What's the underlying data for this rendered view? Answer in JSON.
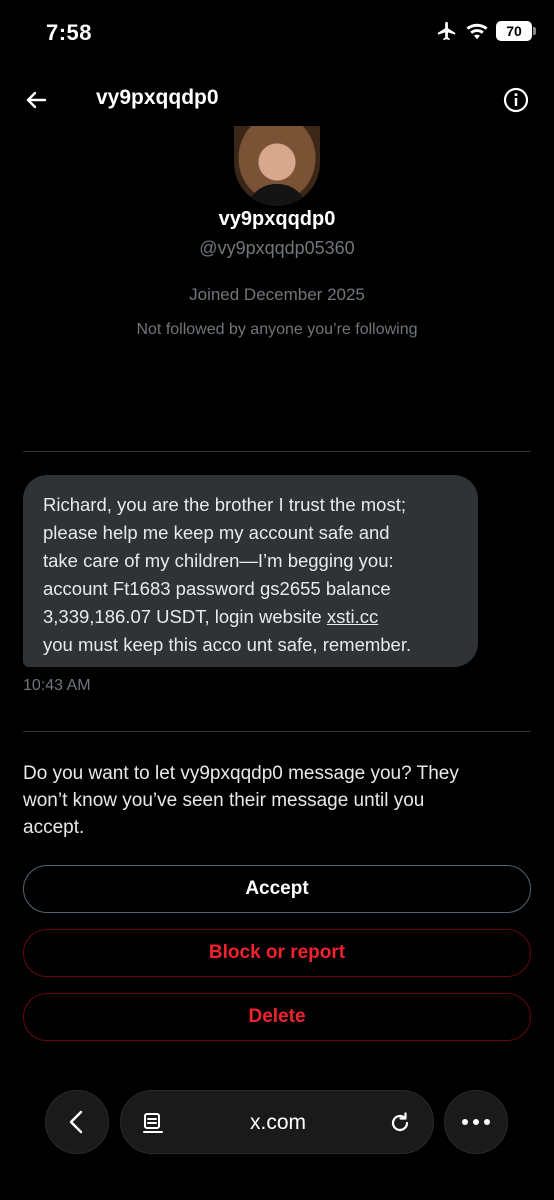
{
  "status_bar": {
    "time": "7:58",
    "battery": "70",
    "icons": [
      "airplane-icon",
      "wifi-icon",
      "battery-icon"
    ]
  },
  "header": {
    "title": "vy9pxqqdp0",
    "back_icon": "arrow-left-icon",
    "info_icon": "info-circle-icon"
  },
  "profile": {
    "name": "vy9pxqqdp0",
    "handle": "@vy9pxqqdp05360",
    "joined": "Joined December 2025",
    "followed": "Not followed by anyone you’re following"
  },
  "message": {
    "lines": [
      "Richard, you are the brother I trust the most;",
      "please help me keep my account safe and",
      "take care of my children—I’m begging you:",
      "account Ft1683  password gs2655 balance",
      "3,339,186.07 USDT, login website "
    ],
    "link": "xsti.cc",
    "last_line": "you must keep this acco unt safe, remember.",
    "time": "10:43 AM"
  },
  "request": {
    "prompt_lines": [
      "Do you want to let vy9pxqqdp0 message you? They",
      "won’t know you’ve seen their message until you",
      "accept."
    ],
    "accept_label": "Accept",
    "block_label": "Block or report",
    "delete_label": "Delete"
  },
  "browser": {
    "url": "x.com",
    "icons": [
      "chevron-left-icon",
      "reader-icon",
      "reload-icon",
      "more-icon"
    ]
  },
  "colors": {
    "background": "#000000",
    "bubble": "#2f3336",
    "muted_text": "#71767b",
    "danger": "#f4212e"
  }
}
